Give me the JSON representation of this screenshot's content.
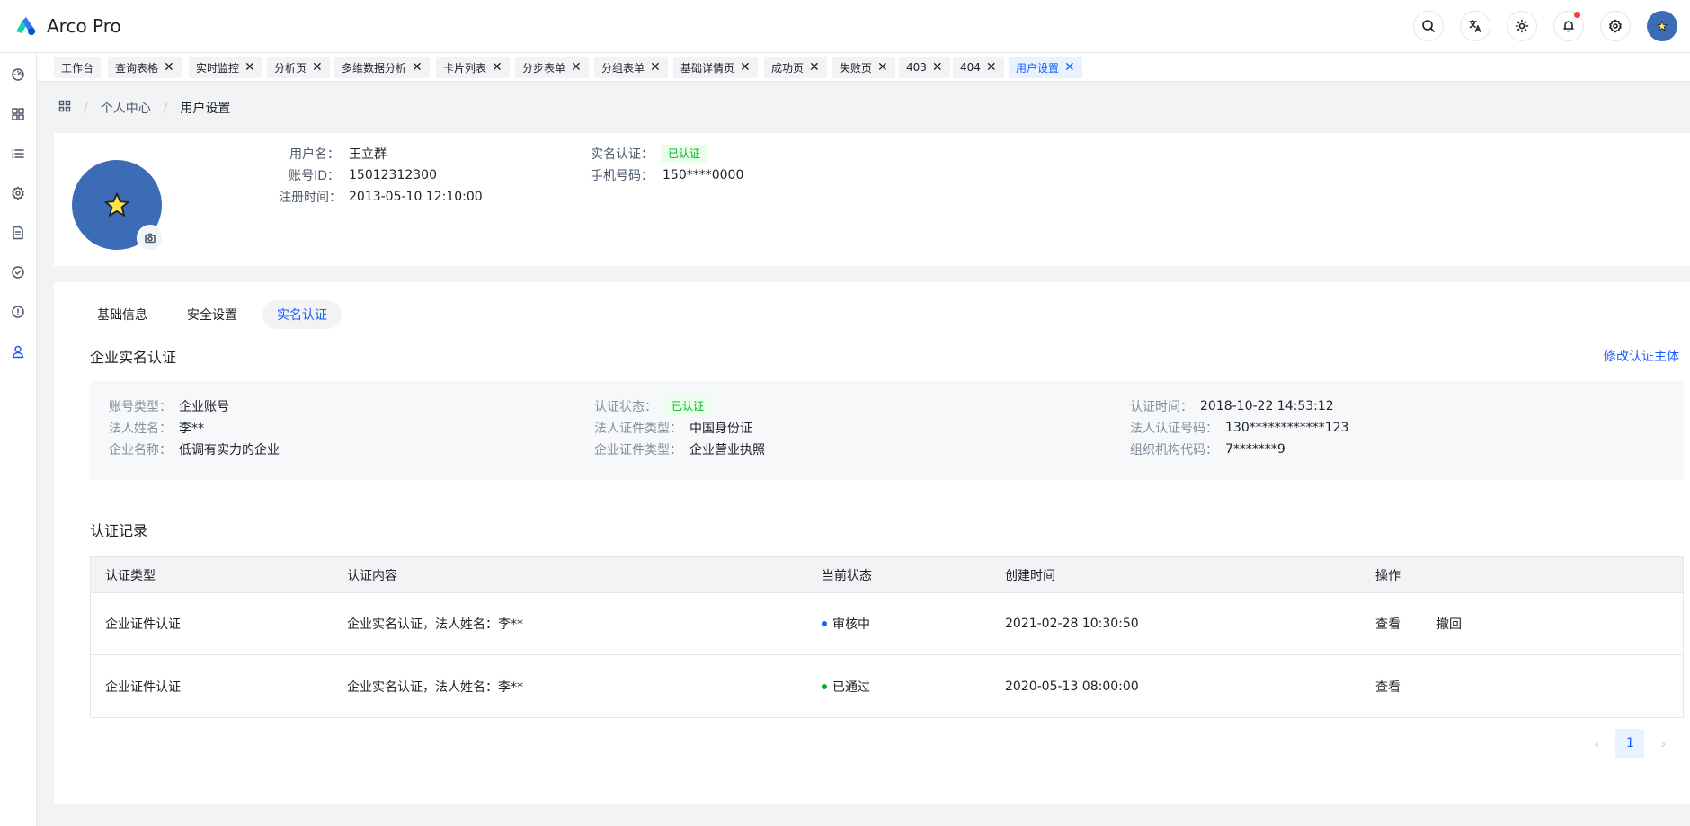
{
  "app": {
    "name": "Arco Pro"
  },
  "navbar": {
    "icons": [
      "search-icon",
      "translate-icon",
      "theme-icon",
      "bell-icon",
      "gear-icon"
    ],
    "notification_color": "#f53f3f"
  },
  "sidebar": {
    "icons": [
      "dashboard-icon",
      "grid-icon",
      "list-icon",
      "settings-icon",
      "document-icon",
      "check-circle-icon",
      "exclamation-icon",
      "user-icon"
    ],
    "active_index": 7
  },
  "tabs_bar": [
    {
      "label": "工作台",
      "closable": false
    },
    {
      "label": "查询表格",
      "closable": true
    },
    {
      "label": "实时监控",
      "closable": true
    },
    {
      "label": "分析页",
      "closable": true
    },
    {
      "label": "多维数据分析",
      "closable": true
    },
    {
      "label": "卡片列表",
      "closable": true
    },
    {
      "label": "分步表单",
      "closable": true
    },
    {
      "label": "分组表单",
      "closable": true
    },
    {
      "label": "基础详情页",
      "closable": true
    },
    {
      "label": "成功页",
      "closable": true
    },
    {
      "label": "失败页",
      "closable": true
    },
    {
      "label": "403",
      "closable": true
    },
    {
      "label": "404",
      "closable": true
    },
    {
      "label": "用户设置",
      "closable": true,
      "active": true
    }
  ],
  "breadcrumb": {
    "items": [
      "个人中心",
      "用户设置"
    ]
  },
  "user": {
    "username_label": "用户名：",
    "username": "王立群",
    "account_id_label": "账号ID：",
    "account_id": "15012312300",
    "reg_time_label": "注册时间：",
    "reg_time": "2013-05-10 12:10:00",
    "verify_label": "实名认证：",
    "verify_status": "已认证",
    "phone_label": "手机号码：",
    "phone": "150****0000"
  },
  "content_tabs": {
    "items": [
      "基础信息",
      "安全设置",
      "实名认证"
    ],
    "active_index": 2
  },
  "enterprise": {
    "title": "企业实名认证",
    "edit_link": "修改认证主体",
    "fields": {
      "account_type_label": "账号类型：",
      "account_type": "企业账号",
      "legal_name_label": "法人姓名：",
      "legal_name": "李**",
      "company_name_label": "企业名称：",
      "company_name": "低调有实力的企业",
      "status_label": "认证状态：",
      "status": "已认证",
      "legal_cert_type_label": "法人证件类型：",
      "legal_cert_type": "中国身份证",
      "company_cert_type_label": "企业证件类型：",
      "company_cert_type": "企业营业执照",
      "verify_time_label": "认证时间：",
      "verify_time": "2018-10-22 14:53:12",
      "legal_cert_no_label": "法人认证号码：",
      "legal_cert_no": "130************123",
      "org_code_label": "组织机构代码：",
      "org_code": "7*******9"
    }
  },
  "records": {
    "title": "认证记录",
    "columns": [
      "认证类型",
      "认证内容",
      "当前状态",
      "创建时间",
      "操作"
    ],
    "rows": [
      {
        "type": "企业证件认证",
        "content": "企业实名认证，法人姓名：李**",
        "status": "审核中",
        "status_color": "#165dff",
        "created": "2021-02-28 10:30:50",
        "actions": [
          "查看",
          "撤回"
        ]
      },
      {
        "type": "企业证件认证",
        "content": "企业实名认证，法人姓名：李**",
        "status": "已通过",
        "status_color": "#00b42a",
        "created": "2020-05-13 08:00:00",
        "actions": [
          "查看"
        ]
      }
    ]
  },
  "pagination": {
    "current": "1"
  }
}
